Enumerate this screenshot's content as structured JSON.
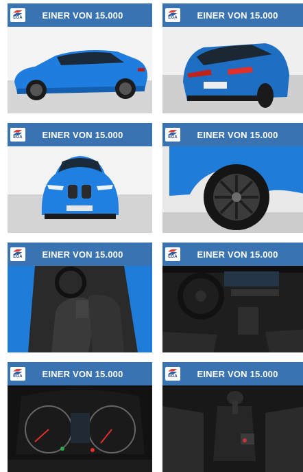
{
  "tiles": [
    {
      "banner": "EINER VON 15.000",
      "logo": "EGA",
      "photo": "car-side-view"
    },
    {
      "banner": "EINER VON 15.000",
      "logo": "EGA",
      "photo": "car-rear-view"
    },
    {
      "banner": "EINER VON 15.000",
      "logo": "EGA",
      "photo": "car-front-view"
    },
    {
      "banner": "EINER VON 15.000",
      "logo": "EGA",
      "photo": "wheel-closeup"
    },
    {
      "banner": "EINER VON 15.000",
      "logo": "EGA",
      "photo": "interior-driver-seat"
    },
    {
      "banner": "EINER VON 15.000",
      "logo": "EGA",
      "photo": "dashboard-steering-wheel"
    },
    {
      "banner": "EINER VON 15.000",
      "logo": "EGA",
      "photo": "instrument-cluster"
    },
    {
      "banner": "EINER VON 15.000",
      "logo": "EGA",
      "photo": "gear-shifter"
    }
  ]
}
